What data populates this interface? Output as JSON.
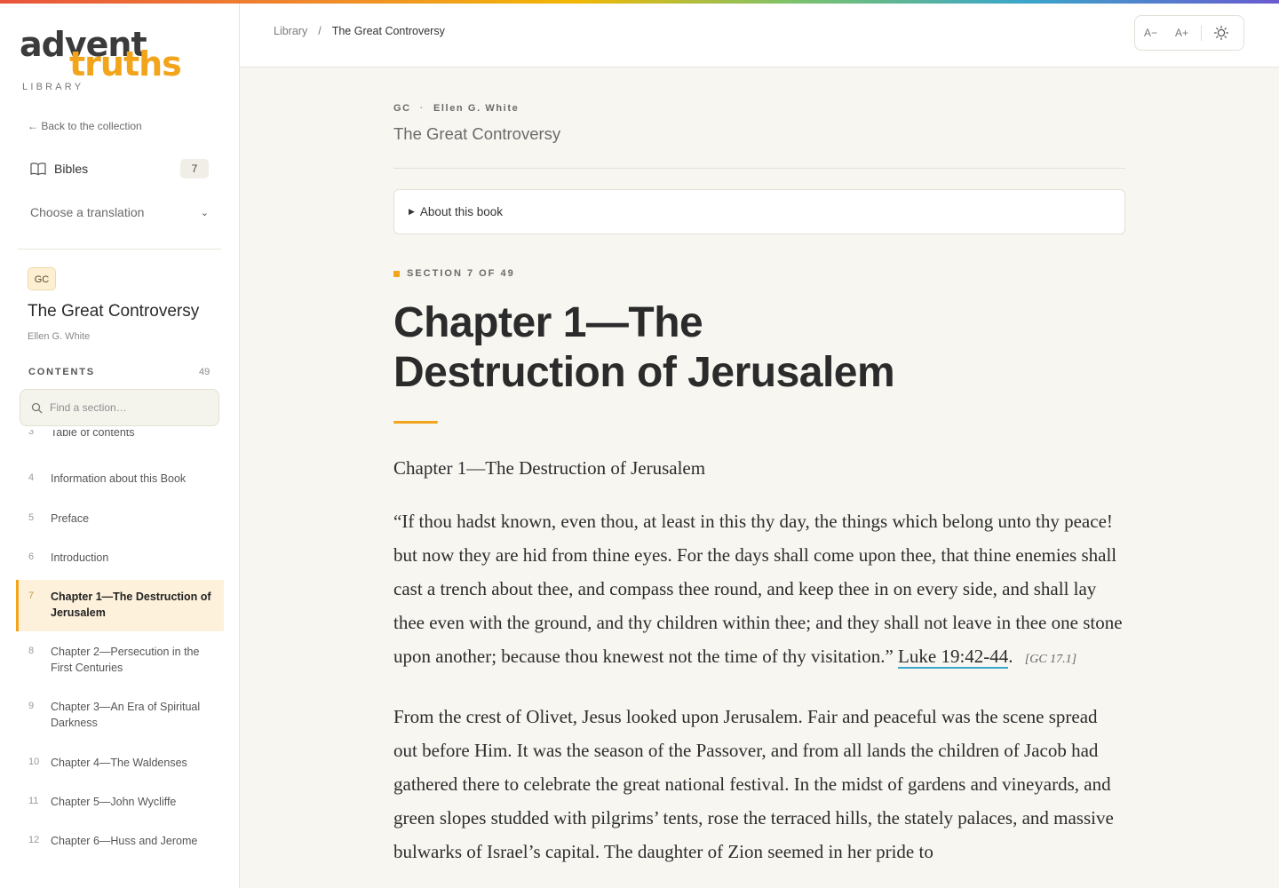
{
  "brand": {
    "word1": "advent",
    "word2": "truths",
    "sub": "LIBRARY"
  },
  "sidebar": {
    "back_link": "← Back to the collection",
    "bibles_label": "Bibles",
    "bibles_count": "7",
    "translation_label": "Choose a translation",
    "book_badge": "GC",
    "book_title": "The Great Controversy",
    "book_author": "Ellen G. White",
    "contents_label": "CONTENTS",
    "contents_count": "49",
    "search_placeholder": "Find a section…",
    "toc": [
      {
        "num": "3",
        "label": "Table of contents"
      },
      {
        "num": "4",
        "label": "Information about this Book"
      },
      {
        "num": "5",
        "label": "Preface"
      },
      {
        "num": "6",
        "label": "Introduction"
      },
      {
        "num": "7",
        "label": "Chapter 1—The Destruction of Jerusalem",
        "active": true
      },
      {
        "num": "8",
        "label": "Chapter 2—Persecution in the First Centuries"
      },
      {
        "num": "9",
        "label": "Chapter 3—An Era of Spiritual Darkness"
      },
      {
        "num": "10",
        "label": "Chapter 4—The Waldenses"
      },
      {
        "num": "11",
        "label": "Chapter 5—John Wycliffe"
      },
      {
        "num": "12",
        "label": "Chapter 6—Huss and Jerome"
      }
    ]
  },
  "header": {
    "breadcrumb": [
      "Library",
      "/",
      "The Great Controversy"
    ],
    "font_decrease": "A−",
    "font_increase": "A+",
    "theme_icon": "sun-icon"
  },
  "main": {
    "meta_code": "GC",
    "meta_sep": "·",
    "meta_author": "Ellen G. White",
    "book_title": "The Great Controversy",
    "about_label": "About this book",
    "section_label": "SECTION 7 OF 49",
    "chapter_title": "Chapter 1—The Destruction of Jerusalem",
    "lead": "Chapter 1—The Destruction of Jerusalem",
    "quote": "“If thou hadst known, even thou, at least in this thy day, the things which belong unto thy peace! but now they are hid from thine eyes. For the days shall come upon thee, that thine enemies shall cast a trench about thee, and compass thee round, and keep thee in on every side, and shall lay thee even with the ground, and thy children within thee; and they shall not leave in thee one stone upon another; because thou knewest not the time of thy visitation.”",
    "quote_ref": "Luke 19:42-44",
    "quote_ref_suffix": ".",
    "quote_page": "[GC 17.1]",
    "paragraph": "From the crest of Olivet, Jesus looked upon Jerusalem. Fair and peaceful was the scene spread out before Him. It was the season of the Passover, and from all lands the children of Jacob had gathered there to celebrate the great national festival. In the midst of gardens and vineyards, and green slopes studded with pilgrims’ tents, rose the terraced hills, the stately palaces, and massive bulwarks of Israel’s capital. The daughter of Zion seemed in her pride to"
  },
  "colors": {
    "accent": "#f2a41a",
    "link_underline": "#3aa6c9",
    "background": "#f7f6f1"
  }
}
